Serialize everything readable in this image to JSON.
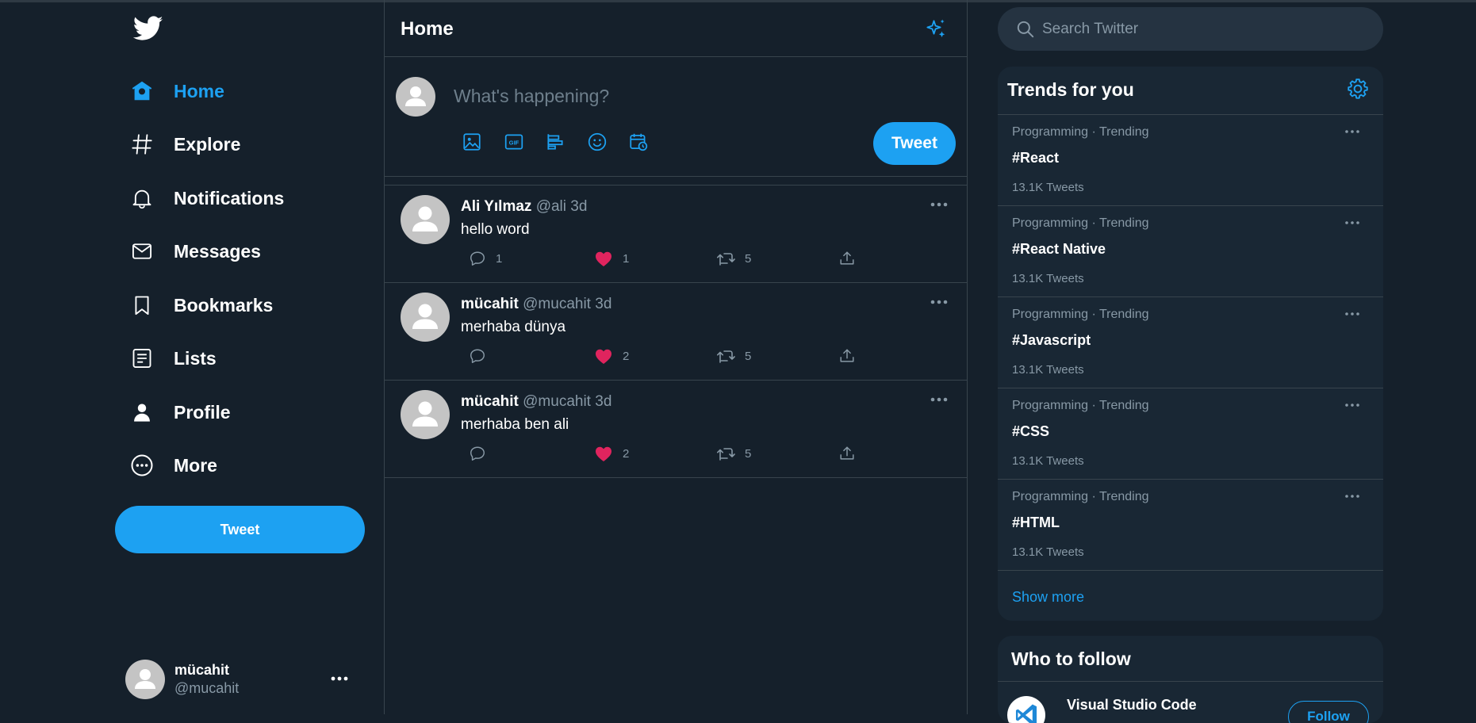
{
  "sidebar": {
    "nav": [
      {
        "label": "Home",
        "icon": "home-icon",
        "active": true
      },
      {
        "label": "Explore",
        "icon": "hashtag-icon"
      },
      {
        "label": "Notifications",
        "icon": "bell-icon"
      },
      {
        "label": "Messages",
        "icon": "mail-icon"
      },
      {
        "label": "Bookmarks",
        "icon": "bookmark-icon"
      },
      {
        "label": "Lists",
        "icon": "list-icon"
      },
      {
        "label": "Profile",
        "icon": "user-icon"
      },
      {
        "label": "More",
        "icon": "more-circle-icon"
      }
    ],
    "tweet_button": "Tweet",
    "account": {
      "name": "mücahit",
      "handle": "@mucahit"
    }
  },
  "main": {
    "title": "Home",
    "composer": {
      "placeholder": "What's happening?",
      "tweet_button": "Tweet"
    },
    "tweets": [
      {
        "name": "Ali Yılmaz",
        "handle": "@ali",
        "time": "3d",
        "text": "hello word",
        "replies": "1",
        "likes": "1",
        "retweets": "5"
      },
      {
        "name": "mücahit",
        "handle": "@mucahit",
        "time": "3d",
        "text": "merhaba dünya",
        "replies": "",
        "likes": "2",
        "retweets": "5"
      },
      {
        "name": "mücahit",
        "handle": "@mucahit",
        "time": "3d",
        "text": "merhaba ben ali",
        "replies": "",
        "likes": "2",
        "retweets": "5"
      }
    ]
  },
  "search": {
    "placeholder": "Search Twitter"
  },
  "trends": {
    "title": "Trends for you",
    "items": [
      {
        "category": "Programming · Trending",
        "name": "#React",
        "count": "13.1K Tweets"
      },
      {
        "category": "Programming · Trending",
        "name": "#React Native",
        "count": "13.1K Tweets"
      },
      {
        "category": "Programming · Trending",
        "name": "#Javascript",
        "count": "13.1K Tweets"
      },
      {
        "category": "Programming · Trending",
        "name": "#CSS",
        "count": "13.1K Tweets"
      },
      {
        "category": "Programming · Trending",
        "name": "#HTML",
        "count": "13.1K Tweets"
      }
    ],
    "show_more": "Show more"
  },
  "who_to_follow": {
    "title": "Who to follow",
    "items": [
      {
        "name": "Visual Studio Code",
        "button": "Follow"
      }
    ]
  },
  "colors": {
    "background": "#15202b",
    "panel": "#192734",
    "accent": "#1da1f2",
    "like": "#e0245e",
    "muted_text": "#8899a6",
    "border": "#38444d"
  }
}
